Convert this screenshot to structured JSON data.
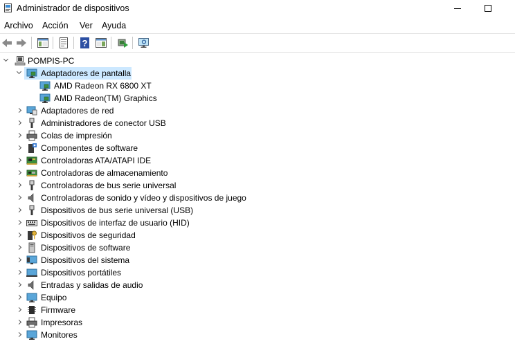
{
  "window": {
    "title": "Administrador de dispositivos"
  },
  "menu": [
    "Archivo",
    "Acción",
    "Ver",
    "Ayuda"
  ],
  "toolbar": [
    "back-icon",
    "forward-icon",
    "show-hide-console-tree-icon",
    "properties-icon",
    "help-icon",
    "action-pane-icon",
    "update-driver-icon",
    "scan-hardware-icon"
  ],
  "tree": {
    "root": "POMPIS-PC",
    "selected": "Adaptadores de pantalla",
    "display_adapters": {
      "label": "Adaptadores de pantalla",
      "children": [
        "AMD Radeon RX 6800 XT",
        "AMD Radeon(TM) Graphics"
      ]
    },
    "categories": [
      "Adaptadores de red",
      "Administradores de conector USB",
      "Colas de impresión",
      "Componentes de software",
      "Controladoras ATA/ATAPI IDE",
      "Controladoras de almacenamiento",
      "Controladoras de bus serie universal",
      "Controladoras de sonido y vídeo y dispositivos de juego",
      "Dispositivos de bus serie universal (USB)",
      "Dispositivos de interfaz de usuario (HID)",
      "Dispositivos de seguridad",
      "Dispositivos de software",
      "Dispositivos del sistema",
      "Dispositivos portátiles",
      "Entradas y salidas de audio",
      "Equipo",
      "Firmware",
      "Impresoras",
      "Monitores"
    ]
  }
}
